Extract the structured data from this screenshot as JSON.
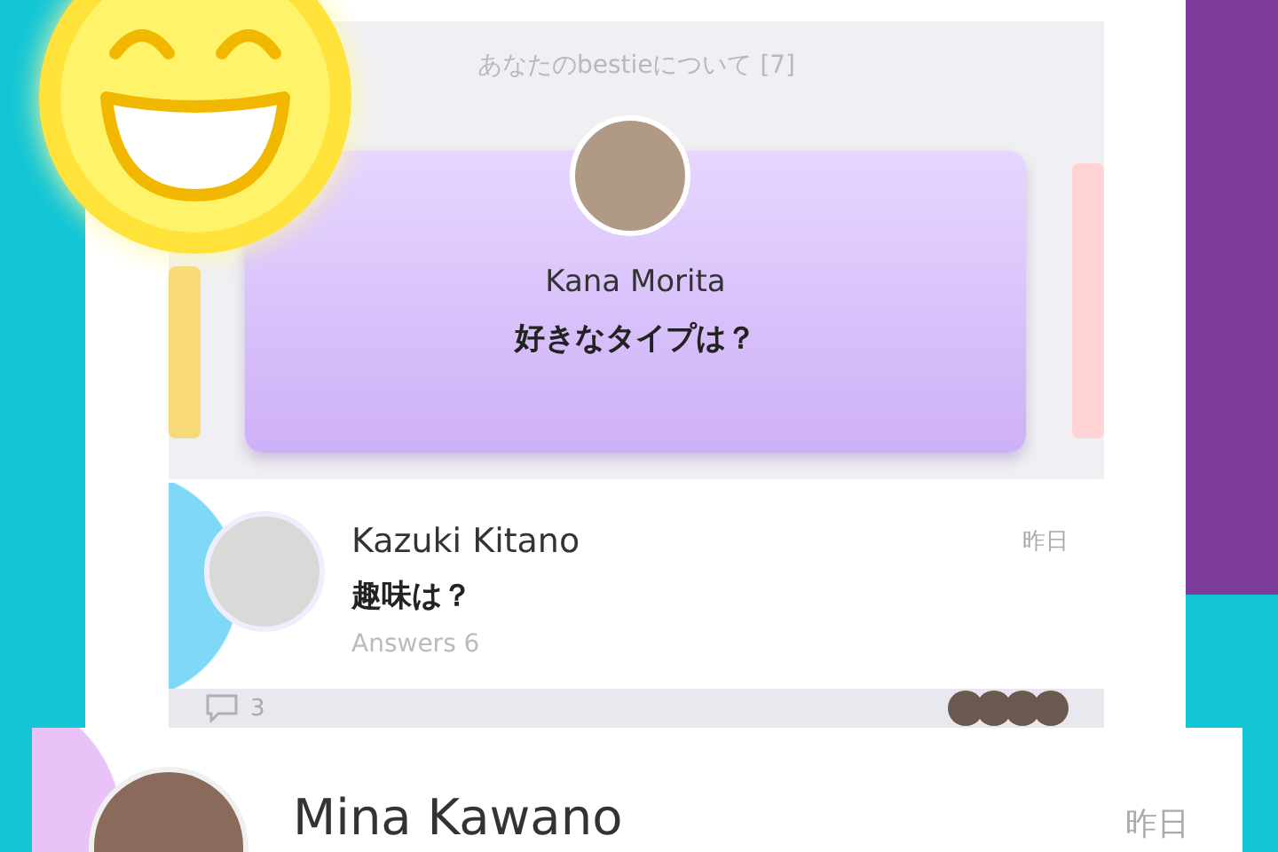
{
  "section_title": "あなたのbestieについて [7]",
  "featured": {
    "name": "Kana Morita",
    "question": "好きなタイプは？"
  },
  "post": {
    "name": "Kazuki Kitano",
    "time": "昨日",
    "question": "趣味は？",
    "answers": "Answers 6",
    "comments": "3"
  },
  "overlay_card": {
    "name": "Mina Kawano",
    "time": "昨日"
  }
}
